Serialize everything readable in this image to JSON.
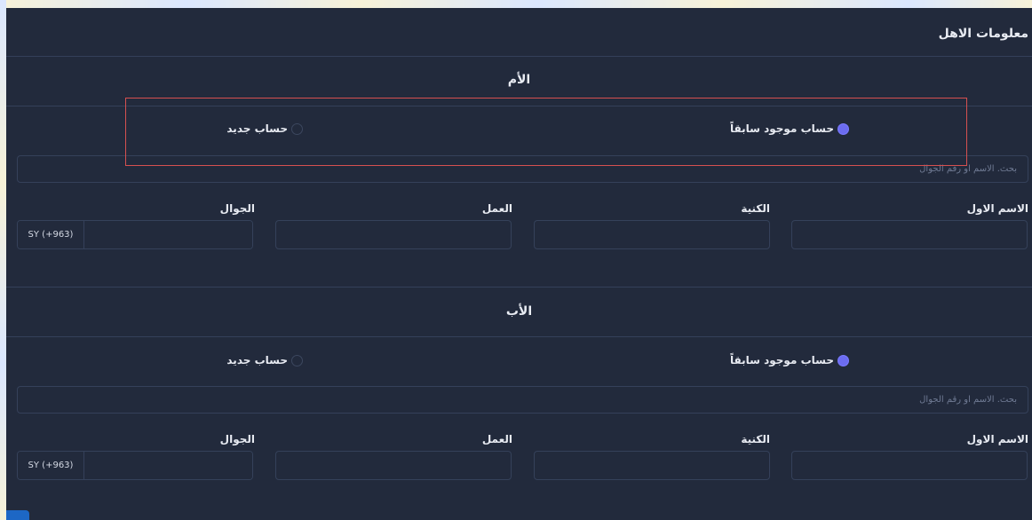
{
  "page": {
    "title": "معلومات الاهل"
  },
  "mother": {
    "title": "الأم",
    "account_type": {
      "existing_label": "حساب موجود سابقاً",
      "new_label": "حساب جديد",
      "selected": "existing"
    },
    "search": {
      "placeholder": "بحث. الاسم او رقم الجوال",
      "value": ""
    },
    "fields": {
      "first_name": {
        "label": "الاسم الاول",
        "value": ""
      },
      "last_name": {
        "label": "الكنية",
        "value": ""
      },
      "work": {
        "label": "العمل",
        "value": ""
      },
      "mobile": {
        "label": "الجوال",
        "country_code": "SY (+963)",
        "value": ""
      }
    }
  },
  "father": {
    "title": "الأب",
    "account_type": {
      "existing_label": "حساب موجود سابقاً",
      "new_label": "حساب جديد",
      "selected": "existing"
    },
    "search": {
      "placeholder": "بحث. الاسم او رقم الجوال",
      "value": ""
    },
    "fields": {
      "first_name": {
        "label": "الاسم الاول",
        "value": ""
      },
      "last_name": {
        "label": "الكنية",
        "value": ""
      },
      "work": {
        "label": "العمل",
        "value": ""
      },
      "mobile": {
        "label": "الجوال",
        "country_code": "SY (+963)",
        "value": ""
      }
    }
  },
  "colors": {
    "card_background": "#222a3c",
    "border": "#35415a",
    "accent_radio": "#6c6cf0",
    "highlight_border": "#d65050",
    "corner_button": "#1d67c5"
  }
}
